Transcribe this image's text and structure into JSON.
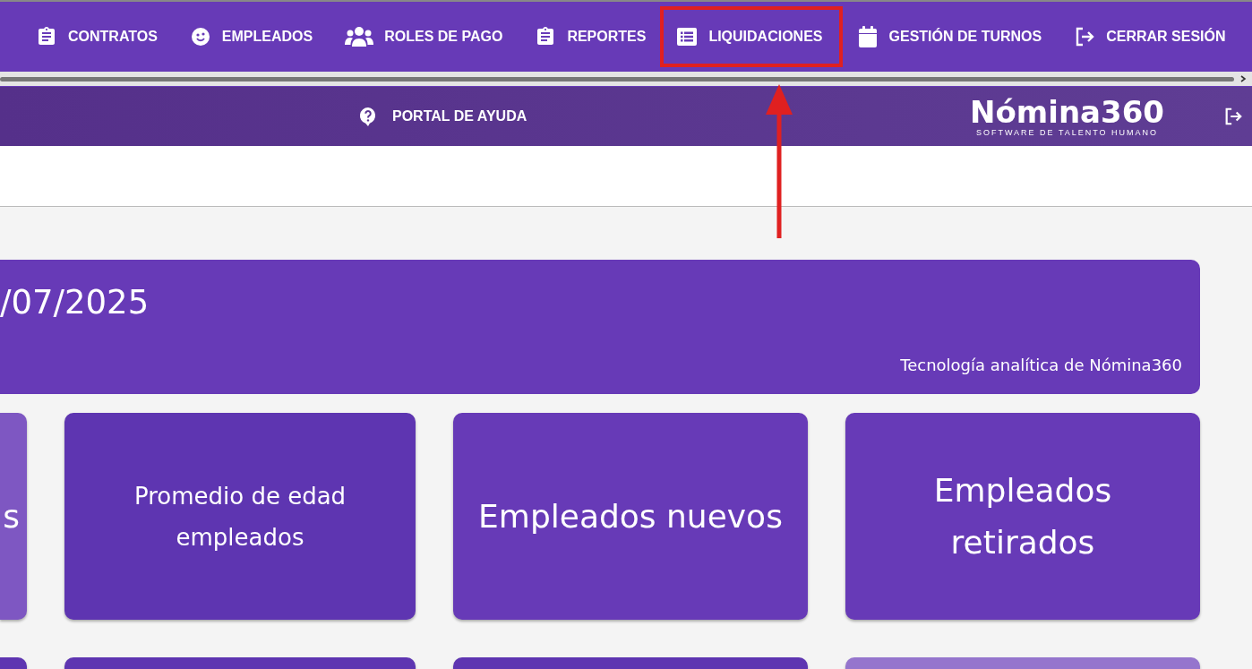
{
  "nav": {
    "items": [
      {
        "label": "CONTRATOS",
        "kind": "clipboard",
        "highlighted": false
      },
      {
        "label": "EMPLEADOS",
        "kind": "face",
        "highlighted": false
      },
      {
        "label": "ROLES DE PAGO",
        "kind": "group",
        "highlighted": false
      },
      {
        "label": "REPORTES",
        "kind": "clipboard",
        "highlighted": false
      },
      {
        "label": "LIQUIDACIONES",
        "kind": "list",
        "highlighted": true
      },
      {
        "label": "GESTIÓN DE TURNOS",
        "kind": "calendar",
        "highlighted": false
      },
      {
        "label": "CERRAR SESIÓN",
        "kind": "logout",
        "highlighted": false
      }
    ]
  },
  "header": {
    "help_link": "PORTAL DE AYUDA",
    "logo": {
      "name": "Nómina360",
      "tagline": "SOFTWARE DE TALENTO HUMANO"
    }
  },
  "banner": {
    "date": "/07/2025",
    "caption": "Tecnología analítica de Nómina360"
  },
  "cards": [
    {
      "text": "s",
      "kind": "large",
      "color": "#7e57c2"
    },
    {
      "text": "Promedio de edad empleados",
      "kind": "normal",
      "color": "#5e35b1"
    },
    {
      "text": "Empleados nuevos",
      "kind": "large",
      "color": "#673ab7"
    },
    {
      "text": "Empleados retirados",
      "kind": "large",
      "color": "#673ab7"
    },
    {
      "color": "#5e35b1"
    },
    {
      "color": "#5e35b1"
    },
    {
      "color": "#5e35b1"
    },
    {
      "color": "#9575cd"
    }
  ]
}
